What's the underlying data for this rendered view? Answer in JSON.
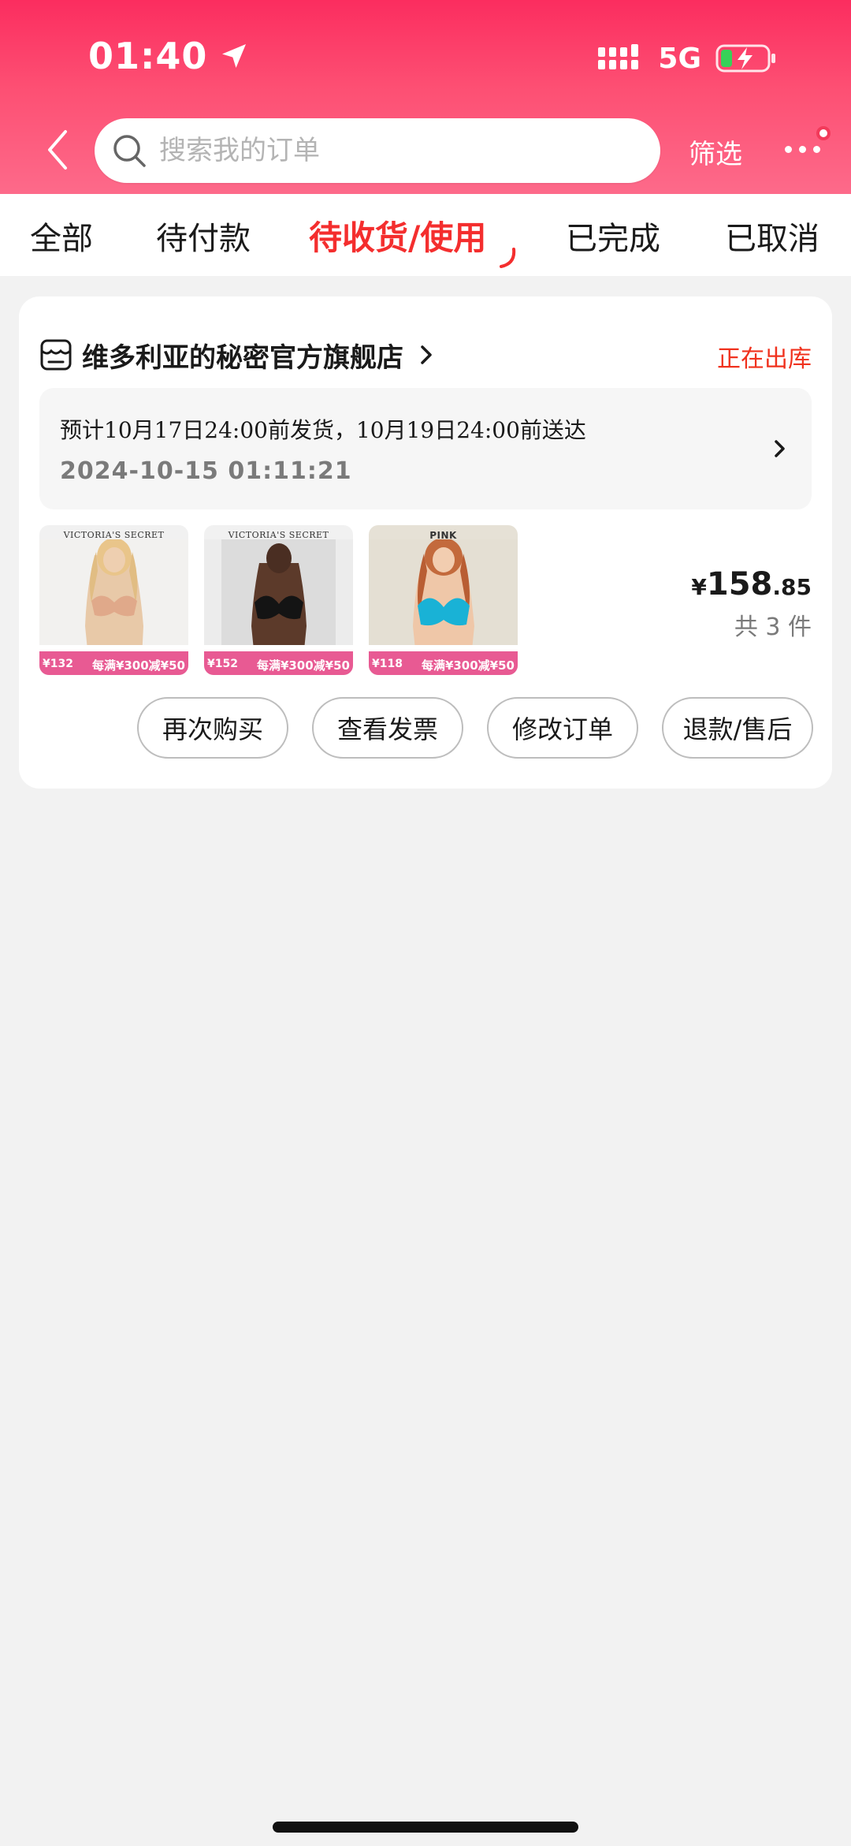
{
  "status_bar": {
    "time": "01:40",
    "network": "5G"
  },
  "search": {
    "placeholder": "搜索我的订单"
  },
  "header": {
    "filter_label": "筛选"
  },
  "tabs": [
    {
      "label": "全部"
    },
    {
      "label": "待付款"
    },
    {
      "label": "待收货/使用",
      "active": true
    },
    {
      "label": "已完成"
    },
    {
      "label": "已取消"
    }
  ],
  "order": {
    "shop_name": "维多利亚的秘密官方旗舰店",
    "status": "正在出库",
    "delivery_note": "预计10月17日24:00前发货，10月19日24:00前送达",
    "order_time": "2024-10-15 01:11:21",
    "products": [
      {
        "brand": "VICTORIA'S SECRET",
        "price": "¥132",
        "promo": "每满¥300减¥50",
        "color": "nude"
      },
      {
        "brand": "VICTORIA'S SECRET",
        "price": "¥152",
        "promo": "每满¥300减¥50",
        "color": "black"
      },
      {
        "brand": "PINK",
        "price": "¥118",
        "promo": "每满¥300减¥50",
        "color": "blue"
      }
    ],
    "price_symbol": "¥",
    "price_integer": "158",
    "price_decimal": ".85",
    "item_count": "共 3 件",
    "actions": {
      "rebuy": "再次购买",
      "invoice": "查看发票",
      "modify": "修改订单",
      "refund": "退款/售后"
    }
  },
  "colors": {
    "header_gradient_top": "#fb2d5f",
    "accent_red": "#f42e2e",
    "status_red": "#f0321e",
    "promo_pink": "#e85a93"
  }
}
